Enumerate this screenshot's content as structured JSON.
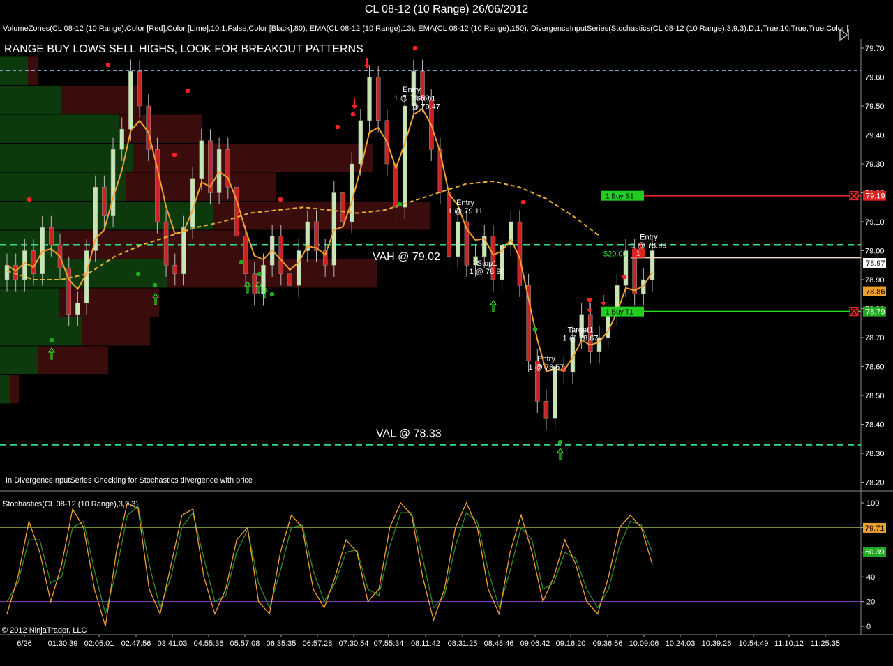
{
  "window": {
    "title": "CL 08-12 (10 Range)  26/06/2012"
  },
  "indicator_line": "VolumeZones(CL 08-12 (10 Range),Color [Red],Color [Lime],10,1,False,Color [Black],80), EMA(CL 08-12 (10 Range),13), EMA(CL 08-12 (10 Range),150), DivergenceInputSeries(Stochastics(CL 08-12 (10 Range),3,9,3).D,1,True,10,True,True,Color [",
  "note": "RANGE BUY LOWS SELL HIGHS, LOOK FOR BREAKOUT PATTERNS",
  "status_text": "In DivergenceInputSeries Checking for Stochastics  divergence with price",
  "copyright": "© 2012 NinjaTrader, LLC",
  "stoch_title": "Stochastics(CL 08-12 (10 Range),3,9,3)",
  "colors": {
    "up": "#c8e6b4",
    "down": "#cc2222",
    "ema13": "#f0a030",
    "ema150": "#e8b030",
    "va": "#33dd88",
    "buy_zone": "#0c3a0c",
    "sell_zone": "#3a0c0c",
    "stoch_k": "#f0a030",
    "stoch_d": "#2e8b2e"
  },
  "chart_data": [
    {
      "type": "candlestick",
      "y_range": [
        78.17,
        79.73
      ],
      "y_ticks": [
        "79.70",
        "79.60",
        "79.50",
        "79.40",
        "79.30",
        "79.20",
        "79.10",
        "79.00",
        "78.90",
        "78.80",
        "78.70",
        "78.60",
        "78.50",
        "78.40",
        "78.30",
        "78.20"
      ],
      "x_ticks": [
        "6/26",
        "01:30:39",
        "02:05:01",
        "02:47:56",
        "03:41:03",
        "04:55:36",
        "05:57:08",
        "06:35:35",
        "06:57:28",
        "07:30:54",
        "07:55:34",
        "08:11:42",
        "08:31:25",
        "08:48:46",
        "09:06:42",
        "09:16:20",
        "09:36:56",
        "10:09:06",
        "10:24:03",
        "10:39:26",
        "10:54:49",
        "11:10:12",
        "11:25:35"
      ],
      "close_path": [
        78.95,
        78.9,
        79.0,
        78.92,
        79.08,
        79.02,
        78.94,
        78.78,
        78.82,
        79.0,
        79.22,
        79.12,
        79.35,
        79.42,
        79.62,
        79.5,
        79.35,
        79.1,
        78.95,
        78.92,
        79.08,
        79.25,
        79.38,
        79.2,
        79.35,
        79.22,
        79.05,
        78.92,
        78.85,
        78.95,
        79.05,
        78.92,
        78.88,
        79.0,
        79.1,
        79.0,
        78.95,
        79.2,
        79.1,
        79.3,
        79.45,
        79.6,
        79.45,
        79.3,
        79.15,
        79.5,
        79.62,
        79.52,
        79.35,
        79.2,
        78.98,
        79.1,
        78.95,
        78.98,
        79.05,
        78.9,
        79.02,
        79.1,
        78.88,
        78.62,
        78.48,
        78.42,
        78.6,
        78.58,
        78.7,
        78.78,
        78.65,
        78.7,
        78.78,
        78.88,
        79.0,
        78.85,
        78.9,
        79.0
      ],
      "value_area": {
        "vah": 79.02,
        "val": 78.33,
        "vah_label": "VAH @ 79.02",
        "val_label": "VAL @ 78.33"
      },
      "ema150_path": [
        78.93,
        78.9,
        78.9,
        78.92,
        78.98,
        79.02,
        79.05,
        79.08,
        79.1,
        79.13,
        79.14,
        79.15,
        79.14,
        79.13,
        79.14,
        79.17,
        79.2,
        79.23,
        79.24,
        79.22,
        79.18,
        79.12,
        79.05
      ],
      "volume_zones": [
        {
          "price": 79.62,
          "buy": 40,
          "sell": 15
        },
        {
          "price": 79.52,
          "buy": 88,
          "sell": 114
        },
        {
          "price": 79.42,
          "buy": 170,
          "sell": 120
        },
        {
          "price": 79.32,
          "buy": 190,
          "sell": 345
        },
        {
          "price": 79.22,
          "buy": 180,
          "sell": 215
        },
        {
          "price": 79.12,
          "buy": 305,
          "sell": 312
        },
        {
          "price": 79.02,
          "buy": 85,
          "sell": 270
        },
        {
          "price": 78.92,
          "buy": 240,
          "sell": 300
        },
        {
          "price": 78.82,
          "buy": 85,
          "sell": 143
        },
        {
          "price": 78.72,
          "buy": 117,
          "sell": 98
        },
        {
          "price": 78.62,
          "buy": 55,
          "sell": 100
        },
        {
          "price": 78.52,
          "buy": 15,
          "sell": 12
        }
      ],
      "markers": [
        {
          "name": "Entry",
          "line2": "1 @ 79.50",
          "price": 79.5
        },
        {
          "name": "Stop1",
          "line2": "@ 79.47",
          "price": 79.47
        },
        {
          "name": "Stop1",
          "line2": "1 @ 78.90",
          "price": 78.9
        },
        {
          "name": "Entry",
          "line2": "1 @ 79.11",
          "price": 79.11
        },
        {
          "name": "Target1",
          "line2": "1 @ 78.67",
          "price": 78.67
        },
        {
          "name": "Entry",
          "line2": "1 @ 78.57",
          "price": 78.57
        },
        {
          "name": "Entry",
          "line2": "1 @ 78.99",
          "price": 78.99
        }
      ],
      "order_lines": [
        {
          "label": "1  Buy S1",
          "price": 79.19,
          "tag": "79.19",
          "color": "#dd2222",
          "tagcolor": "#dd2222"
        },
        {
          "label": "1  Buy T1",
          "price": 78.79,
          "tag": "78.79",
          "color": "#22dd22",
          "tagcolor": "#22aa22"
        }
      ],
      "position": {
        "qty": "1",
        "pnl": "$20.00",
        "price": 78.99
      },
      "price_tags": [
        {
          "price": 78.97,
          "tag": "78.97",
          "bg": "#ffffff",
          "fg": "#000"
        },
        {
          "price": 78.86,
          "tag": "78.86",
          "bg": "#f0a030",
          "fg": "#000"
        }
      ]
    },
    {
      "type": "line",
      "name": "Stochastics",
      "y_range": [
        -8,
        108
      ],
      "y_ticks": [
        "100",
        "80",
        "60",
        "40",
        "20",
        "0"
      ],
      "levels": [
        80,
        20
      ],
      "k_path": [
        10,
        40,
        85,
        60,
        20,
        50,
        95,
        80,
        30,
        0,
        60,
        100,
        95,
        30,
        10,
        50,
        90,
        95,
        40,
        10,
        30,
        70,
        80,
        20,
        10,
        60,
        90,
        80,
        30,
        15,
        40,
        70,
        60,
        20,
        30,
        80,
        100,
        90,
        40,
        5,
        30,
        80,
        100,
        80,
        30,
        10,
        60,
        90,
        60,
        20,
        40,
        70,
        50,
        20,
        10,
        40,
        80,
        90,
        80,
        50
      ],
      "d_path": [
        20,
        35,
        70,
        70,
        35,
        40,
        80,
        85,
        45,
        10,
        45,
        90,
        97,
        50,
        15,
        40,
        80,
        92,
        55,
        20,
        25,
        60,
        78,
        35,
        15,
        45,
        80,
        82,
        45,
        20,
        35,
        60,
        62,
        30,
        25,
        65,
        92,
        92,
        55,
        15,
        25,
        65,
        92,
        85,
        45,
        15,
        45,
        80,
        70,
        30,
        35,
        60,
        55,
        30,
        15,
        30,
        65,
        85,
        82,
        60
      ],
      "last_k": "79.71",
      "last_d": "60.39"
    }
  ]
}
